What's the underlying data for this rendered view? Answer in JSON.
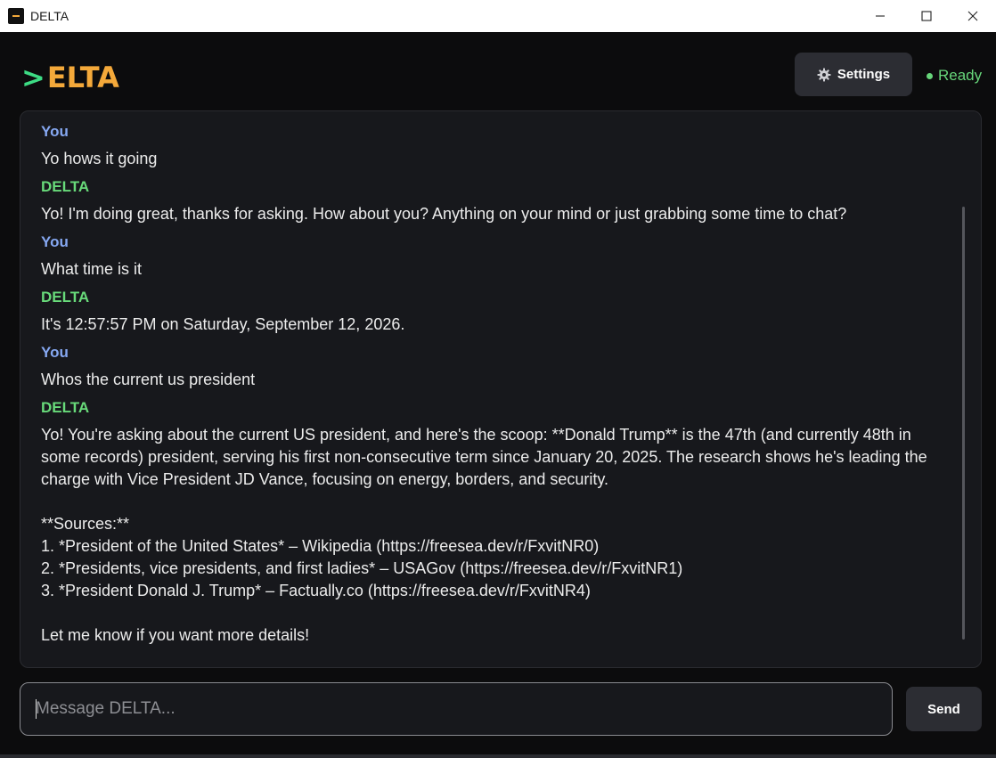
{
  "window": {
    "title": "DELTA",
    "minimize_icon": "minimize-icon",
    "maximize_icon": "maximize-icon",
    "close_icon": "close-icon"
  },
  "header": {
    "logo_prompt": ">",
    "logo_text": "ELTA",
    "settings_label": "Settings",
    "settings_icon": "gear-icon",
    "status_text": "Ready",
    "colors": {
      "accent": "#f4a93a",
      "prompt": "#3ddc84",
      "status": "#67d67a"
    }
  },
  "messages": [
    {
      "author": "You",
      "role": "you",
      "text": "Yo hows it going"
    },
    {
      "author": "DELTA",
      "role": "delta",
      "text": "Yo! I'm doing great, thanks for asking. How about you? Anything on your mind or just grabbing some time to chat?"
    },
    {
      "author": "You",
      "role": "you",
      "text": "What time is it"
    },
    {
      "author": "DELTA",
      "role": "delta",
      "text": "It's 12:57:57 PM on Saturday, September 12, 2026."
    },
    {
      "author": "You",
      "role": "you",
      "text": "Whos the current us president"
    },
    {
      "author": "DELTA",
      "role": "delta",
      "text": "Yo! You're asking about the current US president, and here's the scoop: **Donald Trump** is the 47th (and currently 48th in\nsome records) president, serving his first non-consecutive term since January 20, 2025. The research shows he's leading the\ncharge with Vice President JD Vance, focusing on energy, borders, and security.\n\n**Sources:**\n1. *President of the United States* – Wikipedia (https://freesea.dev/r/FxvitNR0)\n2. *Presidents, vice presidents, and first ladies* – USAGov (https://freesea.dev/r/FxvitNR1)\n3. *President Donald J. Trump* – Factually.co (https://freesea.dev/r/FxvitNR4)\n\nLet me know if you want more details!"
    }
  ],
  "composer": {
    "placeholder": "Message DELTA...",
    "value": "",
    "send_label": "Send"
  }
}
